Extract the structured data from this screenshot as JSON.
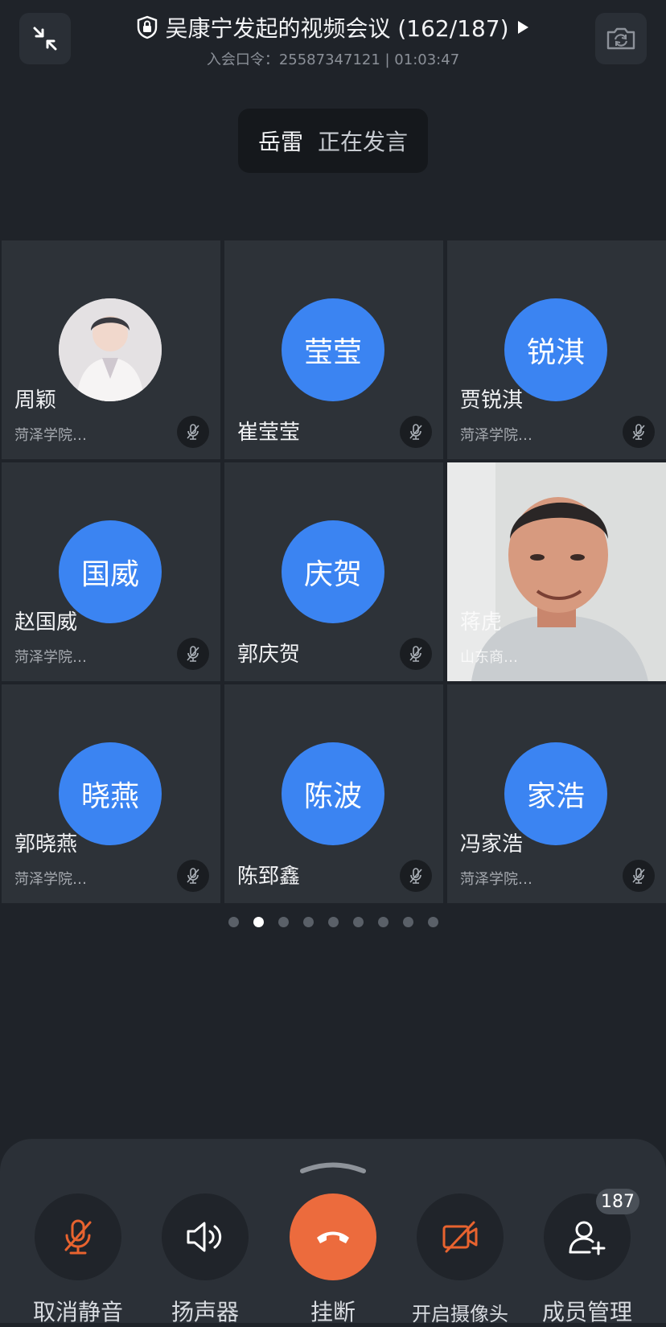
{
  "header": {
    "title": "吴康宁发起的视频会议 (162/187)",
    "subtitle": "入会口令：25587347121 | 01:03:47"
  },
  "speaker": {
    "name": "岳雷",
    "status": "正在发言"
  },
  "tiles": [
    {
      "name": "周颖",
      "org": "菏泽学院…",
      "avatar_text": "",
      "mic": "muted"
    },
    {
      "name": "崔莹莹",
      "org": "",
      "avatar_text": "莹莹",
      "mic": "muted"
    },
    {
      "name": "贾锐淇",
      "org": "菏泽学院…",
      "avatar_text": "锐淇",
      "mic": "muted"
    },
    {
      "name": "赵国威",
      "org": "菏泽学院…",
      "avatar_text": "国威",
      "mic": "muted"
    },
    {
      "name": "郭庆贺",
      "org": "",
      "avatar_text": "庆贺",
      "mic": "muted"
    },
    {
      "name": "蒋虎",
      "org": "山东商…",
      "avatar_text": "",
      "mic": ""
    },
    {
      "name": "郭晓燕",
      "org": "菏泽学院…",
      "avatar_text": "晓燕",
      "mic": "muted"
    },
    {
      "name": "陈郅鑫",
      "org": "",
      "avatar_text": "陈波",
      "mic": "muted"
    },
    {
      "name": "冯家浩",
      "org": "菏泽学院…",
      "avatar_text": "家浩",
      "mic": "muted"
    }
  ],
  "pagination": {
    "total": 9,
    "current": 2
  },
  "toolbar": {
    "unmute_label": "取消静音",
    "speaker_label": "扬声器",
    "hangup_label": "挂断",
    "camera_label": "开启摄像头",
    "members_label": "成员管理",
    "members_count": "187"
  },
  "colors": {
    "background": "#1f2329",
    "tile": "#2d3238",
    "avatar_blue": "#3b84f2",
    "hangup_orange": "#ec6b3d",
    "icon_orange": "#e8632f"
  }
}
